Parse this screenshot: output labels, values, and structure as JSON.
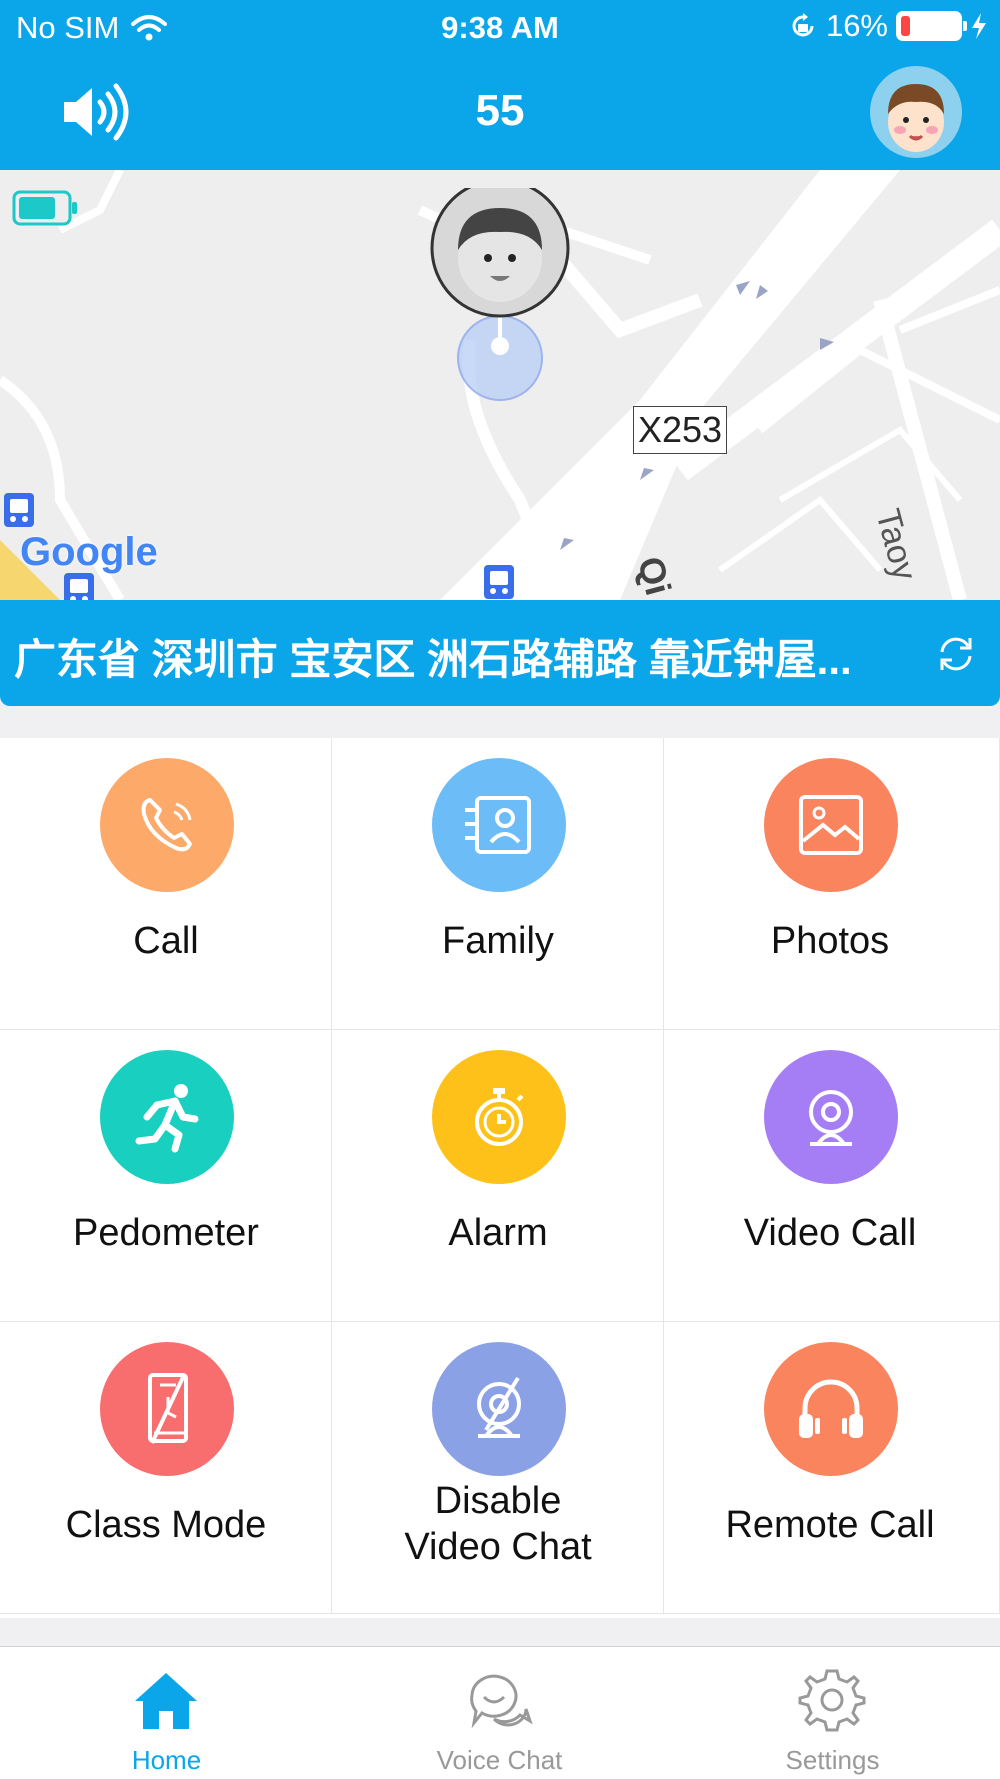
{
  "status_bar": {
    "carrier": "No SIM",
    "time": "9:38 AM",
    "battery_percent": "16%",
    "battery_level": 0.16
  },
  "header": {
    "title": "55"
  },
  "map": {
    "road_label": "X253",
    "road_label_2": "Qi",
    "road_label_3": "Taoy",
    "google_logo": "Google"
  },
  "address": {
    "text": "广东省 深圳市 宝安区 洲石路辅路 靠近钟屋..."
  },
  "grid": {
    "items": [
      {
        "label": "Call",
        "color": "#fda96a",
        "icon": "phone-icon"
      },
      {
        "label": "Family",
        "color": "#6cbdf7",
        "icon": "contact-card-icon"
      },
      {
        "label": "Photos",
        "color": "#f9845e",
        "icon": "image-icon"
      },
      {
        "label": "Pedometer",
        "color": "#19cfbf",
        "icon": "running-man-icon"
      },
      {
        "label": "Alarm",
        "color": "#fec119",
        "icon": "stopwatch-icon"
      },
      {
        "label": "Video Call",
        "color": "#a57ef6",
        "icon": "webcam-icon"
      },
      {
        "label": "Class Mode",
        "color": "#f86e6e",
        "icon": "phone-off-icon"
      },
      {
        "label_line1": "Disable",
        "label_line2": "Video Chat",
        "color": "#8ba1e6",
        "icon": "webcam-off-icon"
      },
      {
        "label": "Remote Call",
        "color": "#f9845e",
        "icon": "headphones-icon"
      }
    ]
  },
  "tabbar": {
    "tabs": [
      {
        "label": "Home",
        "active": true,
        "icon": "home-icon"
      },
      {
        "label": "Voice Chat",
        "active": false,
        "icon": "chat-bubbles-icon"
      },
      {
        "label": "Settings",
        "active": false,
        "icon": "gear-icon"
      }
    ],
    "active_color": "#0ba6ea",
    "inactive_color": "#999999"
  }
}
